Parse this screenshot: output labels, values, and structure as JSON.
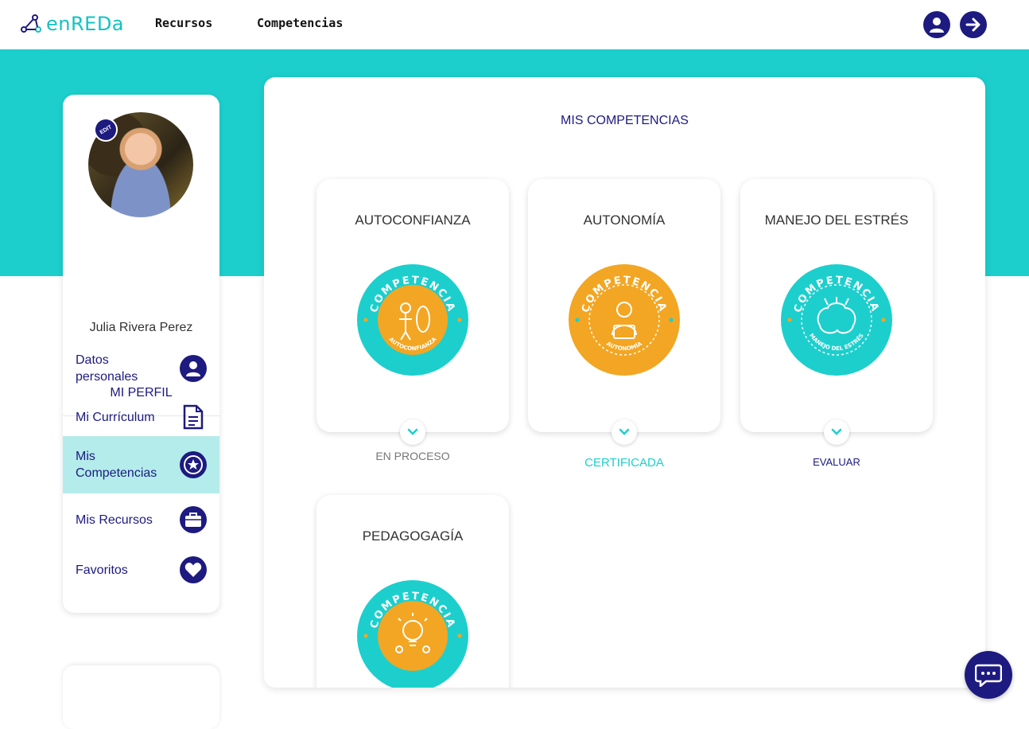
{
  "header": {
    "logo_text": "enREDa",
    "nav": [
      "Recursos",
      "Competencias"
    ]
  },
  "profile": {
    "name": "Julia Rivera Perez",
    "section_title": "MI PERFIL",
    "menu": [
      {
        "label": "Datos personales",
        "icon": "user-icon",
        "active": false
      },
      {
        "label": "Mi Currículum",
        "icon": "document-icon",
        "active": false
      },
      {
        "label": "Mis Competencias",
        "icon": "star-badge-icon",
        "active": true
      },
      {
        "label": "Mis Recursos",
        "icon": "briefcase-icon",
        "active": false
      },
      {
        "label": "Favoritos",
        "icon": "heart-icon",
        "active": false
      }
    ]
  },
  "main": {
    "title": "MIS COMPETENCIAS",
    "competencies": [
      {
        "title": "AUTOCONFIANZA",
        "badge_word": "COMPETENCIA",
        "badge_caption": "AUTOCONFIANZA",
        "status": "EN PROCESO"
      },
      {
        "title": "AUTONOMÍA",
        "badge_word": "COMPETENCIA",
        "badge_caption": "AUTONOMÍA",
        "status": "CERTIFICADA"
      },
      {
        "title": "MANEJO DEL ESTRÉS",
        "badge_word": "COMPETENCIA",
        "badge_caption": "MANEJO DEL ESTRÉS",
        "status": "EVALUAR"
      },
      {
        "title": "PEDAGOGAGÍA",
        "badge_word": "COMPETENCIA",
        "badge_caption": "",
        "status": ""
      }
    ]
  },
  "colors": {
    "teal": "#1ccfcd",
    "navy": "#1d1a80",
    "orange": "#f2a623",
    "active_bg": "#b3ecea"
  }
}
